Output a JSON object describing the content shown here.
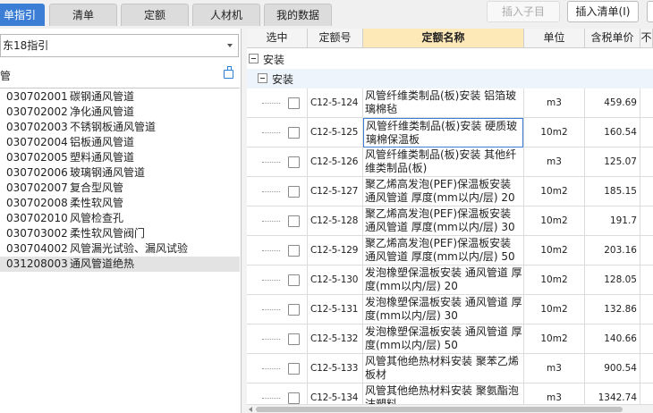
{
  "tabs": [
    {
      "label": "单指引",
      "active": true
    },
    {
      "label": "清单",
      "active": false
    },
    {
      "label": "定额",
      "active": false
    },
    {
      "label": "人材机",
      "active": false
    },
    {
      "label": "我的数据",
      "active": false
    }
  ],
  "toolbar": {
    "insert_child": "插入子目",
    "insert_list": "插入清单(I)"
  },
  "left": {
    "combo_value": "东18指引",
    "panel_title": "管",
    "items": [
      {
        "code": "030702001",
        "name": "碳钢通风管道"
      },
      {
        "code": "030702002",
        "name": "净化通风管道"
      },
      {
        "code": "030702003",
        "name": "不锈钢板通风管道"
      },
      {
        "code": "030702004",
        "name": "铝板通风管道"
      },
      {
        "code": "030702005",
        "name": "塑料通风管道"
      },
      {
        "code": "030702006",
        "name": "玻璃钢通风管道"
      },
      {
        "code": "030702007",
        "name": "复合型风管"
      },
      {
        "code": "030702008",
        "name": "柔性软风管"
      },
      {
        "code": "030702010",
        "name": "风管检查孔"
      },
      {
        "code": "030703002",
        "name": "柔性软风管阀门"
      },
      {
        "code": "030704002",
        "name": "风管漏光试验、漏风试验"
      },
      {
        "code": "031208003",
        "name": "通风管道绝热",
        "selected": true
      }
    ]
  },
  "grid": {
    "headers": [
      "选中",
      "定额号",
      "定额名称",
      "单位",
      "含税单价",
      "不"
    ],
    "group1": "安装",
    "group2": "安装",
    "rows": [
      {
        "code": "C12-5-124",
        "name": "风管纤维类制品(板)安装 铝箔玻璃棉毡",
        "unit": "m3",
        "price": "459.69"
      },
      {
        "code": "C12-5-125",
        "name": "风管纤维类制品(板)安装 硬质玻璃棉保温板",
        "unit": "10m2",
        "price": "160.54",
        "focused": true
      },
      {
        "code": "C12-5-126",
        "name": "风管纤维类制品(板)安装 其他纤维类制品(板)",
        "unit": "m3",
        "price": "125.07"
      },
      {
        "code": "C12-5-127",
        "name": "聚乙烯高发泡(PEF)保温板安装 通风管道 厚度(mm以内/层) 20",
        "unit": "10m2",
        "price": "185.15"
      },
      {
        "code": "C12-5-128",
        "name": "聚乙烯高发泡(PEF)保温板安装 通风管道 厚度(mm以内/层) 30",
        "unit": "10m2",
        "price": "191.7"
      },
      {
        "code": "C12-5-129",
        "name": "聚乙烯高发泡(PEF)保温板安装 通风管道 厚度(mm以内/层) 50",
        "unit": "10m2",
        "price": "203.16"
      },
      {
        "code": "C12-5-130",
        "name": "发泡橡塑保温板安装 通风管道 厚度(mm以内/层) 20",
        "unit": "10m2",
        "price": "128.05"
      },
      {
        "code": "C12-5-131",
        "name": "发泡橡塑保温板安装 通风管道 厚度(mm以内/层) 30",
        "unit": "10m2",
        "price": "132.86"
      },
      {
        "code": "C12-5-132",
        "name": "发泡橡塑保温板安装 通风管道 厚度(mm以内/层) 50",
        "unit": "10m2",
        "price": "140.66"
      },
      {
        "code": "C12-5-133",
        "name": "风管其他绝热材料安装 聚苯乙烯板材",
        "unit": "m3",
        "price": "900.54"
      },
      {
        "code": "C12-5-134",
        "name": "风管其他绝热材料安装 聚氨酯泡沫塑料",
        "unit": "m3",
        "price": "1342.74"
      }
    ]
  }
}
